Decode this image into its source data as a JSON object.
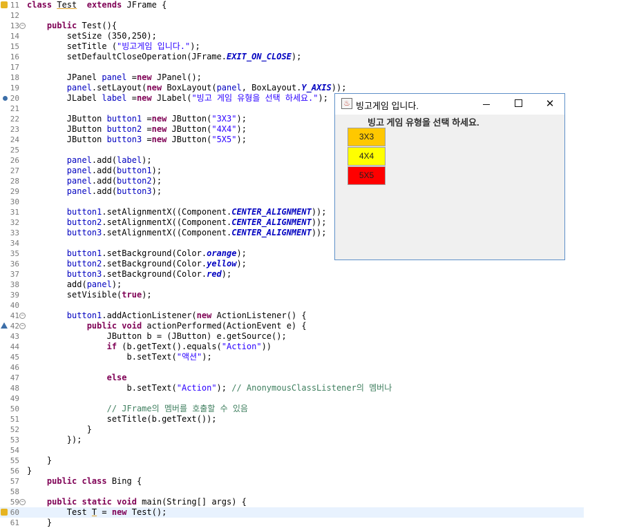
{
  "editor": {
    "lines": [
      {
        "num": "11",
        "segments": [
          [
            "kw",
            "class "
          ],
          [
            "ul",
            "Test"
          ],
          [
            "",
            "  "
          ],
          [
            "kw",
            "extends"
          ],
          [
            "",
            " JFrame {"
          ]
        ]
      },
      {
        "num": "12",
        "segments": []
      },
      {
        "num": "13",
        "segments": [
          [
            "",
            "    "
          ],
          [
            "kw",
            "public"
          ],
          [
            "",
            " Test(){"
          ]
        ]
      },
      {
        "num": "14",
        "segments": [
          [
            "",
            "        setSize (350,250);"
          ]
        ]
      },
      {
        "num": "15",
        "segments": [
          [
            "",
            "        setTitle ("
          ],
          [
            "str",
            "\"빙고게임 입니다.\""
          ],
          [
            "",
            ");"
          ]
        ]
      },
      {
        "num": "16",
        "segments": [
          [
            "",
            "        setDefaultCloseOperation(JFrame."
          ],
          [
            "sfld",
            "EXIT_ON_CLOSE"
          ],
          [
            "",
            ");"
          ]
        ]
      },
      {
        "num": "17",
        "segments": []
      },
      {
        "num": "18",
        "segments": [
          [
            "",
            "        JPanel "
          ],
          [
            "fld",
            "panel"
          ],
          [
            "",
            " ="
          ],
          [
            "kw",
            "new"
          ],
          [
            "",
            " JPanel();"
          ]
        ]
      },
      {
        "num": "19",
        "segments": [
          [
            "",
            "        "
          ],
          [
            "fld",
            "panel"
          ],
          [
            "",
            ".setLayout("
          ],
          [
            "kw",
            "new"
          ],
          [
            "",
            " BoxLayout("
          ],
          [
            "fld",
            "panel"
          ],
          [
            "",
            ", BoxLayout."
          ],
          [
            "sfld",
            "Y_AXIS"
          ],
          [
            "",
            "));"
          ]
        ]
      },
      {
        "num": "20",
        "segments": [
          [
            "",
            "        JLabel "
          ],
          [
            "fld",
            "label"
          ],
          [
            "",
            " ="
          ],
          [
            "kw",
            "new"
          ],
          [
            "",
            " JLabel("
          ],
          [
            "str",
            "\"빙고 게임 유형을 선택 하세요.\""
          ],
          [
            "",
            ");"
          ]
        ]
      },
      {
        "num": "21",
        "segments": []
      },
      {
        "num": "22",
        "segments": [
          [
            "",
            "        JButton "
          ],
          [
            "fld",
            "button1"
          ],
          [
            "",
            " ="
          ],
          [
            "kw",
            "new"
          ],
          [
            "",
            " JButton("
          ],
          [
            "str",
            "\"3X3\""
          ],
          [
            "",
            ");"
          ]
        ]
      },
      {
        "num": "23",
        "segments": [
          [
            "",
            "        JButton "
          ],
          [
            "fld",
            "button2"
          ],
          [
            "",
            " ="
          ],
          [
            "kw",
            "new"
          ],
          [
            "",
            " JButton("
          ],
          [
            "str",
            "\"4X4\""
          ],
          [
            "",
            ");"
          ]
        ]
      },
      {
        "num": "24",
        "segments": [
          [
            "",
            "        JButton "
          ],
          [
            "fld",
            "button3"
          ],
          [
            "",
            " ="
          ],
          [
            "kw",
            "new"
          ],
          [
            "",
            " JButton("
          ],
          [
            "str",
            "\"5X5\""
          ],
          [
            "",
            ");"
          ]
        ]
      },
      {
        "num": "25",
        "segments": []
      },
      {
        "num": "26",
        "segments": [
          [
            "",
            "        "
          ],
          [
            "fld",
            "panel"
          ],
          [
            "",
            ".add("
          ],
          [
            "fld",
            "label"
          ],
          [
            "",
            ");"
          ]
        ]
      },
      {
        "num": "27",
        "segments": [
          [
            "",
            "        "
          ],
          [
            "fld",
            "panel"
          ],
          [
            "",
            ".add("
          ],
          [
            "fld",
            "button1"
          ],
          [
            "",
            ");"
          ]
        ]
      },
      {
        "num": "28",
        "segments": [
          [
            "",
            "        "
          ],
          [
            "fld",
            "panel"
          ],
          [
            "",
            ".add("
          ],
          [
            "fld",
            "button2"
          ],
          [
            "",
            ");"
          ]
        ]
      },
      {
        "num": "29",
        "segments": [
          [
            "",
            "        "
          ],
          [
            "fld",
            "panel"
          ],
          [
            "",
            ".add("
          ],
          [
            "fld",
            "button3"
          ],
          [
            "",
            ");"
          ]
        ]
      },
      {
        "num": "30",
        "segments": []
      },
      {
        "num": "31",
        "segments": [
          [
            "",
            "        "
          ],
          [
            "fld",
            "button1"
          ],
          [
            "",
            ".setAlignmentX((Component."
          ],
          [
            "sfld",
            "CENTER_ALIGNMENT"
          ],
          [
            "",
            "));"
          ]
        ]
      },
      {
        "num": "32",
        "segments": [
          [
            "",
            "        "
          ],
          [
            "fld",
            "button2"
          ],
          [
            "",
            ".setAlignmentX((Component."
          ],
          [
            "sfld",
            "CENTER_ALIGNMENT"
          ],
          [
            "",
            "));"
          ]
        ]
      },
      {
        "num": "33",
        "segments": [
          [
            "",
            "        "
          ],
          [
            "fld",
            "button3"
          ],
          [
            "",
            ".setAlignmentX((Component."
          ],
          [
            "sfld",
            "CENTER_ALIGNMENT"
          ],
          [
            "",
            "));"
          ]
        ]
      },
      {
        "num": "34",
        "segments": []
      },
      {
        "num": "35",
        "segments": [
          [
            "",
            "        "
          ],
          [
            "fld",
            "button1"
          ],
          [
            "",
            ".setBackground(Color."
          ],
          [
            "sfld",
            "orange"
          ],
          [
            "",
            ");"
          ]
        ]
      },
      {
        "num": "36",
        "segments": [
          [
            "",
            "        "
          ],
          [
            "fld",
            "button2"
          ],
          [
            "",
            ".setBackground(Color."
          ],
          [
            "sfld",
            "yellow"
          ],
          [
            "",
            ");"
          ]
        ]
      },
      {
        "num": "37",
        "segments": [
          [
            "",
            "        "
          ],
          [
            "fld",
            "button3"
          ],
          [
            "",
            ".setBackground(Color."
          ],
          [
            "sfld",
            "red"
          ],
          [
            "",
            ");"
          ]
        ]
      },
      {
        "num": "38",
        "segments": [
          [
            "",
            "        add("
          ],
          [
            "fld",
            "panel"
          ],
          [
            "",
            ");"
          ]
        ]
      },
      {
        "num": "39",
        "segments": [
          [
            "",
            "        setVisible("
          ],
          [
            "kw",
            "true"
          ],
          [
            "",
            ");"
          ]
        ]
      },
      {
        "num": "40",
        "segments": []
      },
      {
        "num": "41",
        "segments": [
          [
            "",
            "        "
          ],
          [
            "fld",
            "button1"
          ],
          [
            "",
            ".addActionListener("
          ],
          [
            "kw",
            "new"
          ],
          [
            "",
            " ActionListener() {"
          ]
        ]
      },
      {
        "num": "42",
        "segments": [
          [
            "",
            "            "
          ],
          [
            "kw",
            "public"
          ],
          [
            "kw",
            " void"
          ],
          [
            "",
            " actionPerformed(ActionEvent e) {"
          ]
        ]
      },
      {
        "num": "43",
        "segments": [
          [
            "",
            "                JButton b = (JButton) e.getSource();"
          ]
        ]
      },
      {
        "num": "44",
        "segments": [
          [
            "",
            "                "
          ],
          [
            "kw",
            "if"
          ],
          [
            "",
            " (b.getText().equals("
          ],
          [
            "str",
            "\"Action\""
          ],
          [
            "",
            "))"
          ]
        ]
      },
      {
        "num": "45",
        "segments": [
          [
            "",
            "                    b.setText("
          ],
          [
            "str",
            "\"액션\""
          ],
          [
            "",
            ");"
          ]
        ]
      },
      {
        "num": "46",
        "segments": []
      },
      {
        "num": "47",
        "segments": [
          [
            "",
            "                "
          ],
          [
            "kw",
            "else"
          ]
        ]
      },
      {
        "num": "48",
        "segments": [
          [
            "",
            "                    b.setText("
          ],
          [
            "str",
            "\"Action\""
          ],
          [
            "",
            "); "
          ],
          [
            "cmt",
            "// AnonymousClassListener의 멤버나"
          ]
        ]
      },
      {
        "num": "49",
        "segments": []
      },
      {
        "num": "50",
        "segments": [
          [
            "",
            "                "
          ],
          [
            "cmt",
            "// JFrame의 멤버를 호출할 수 있음"
          ]
        ]
      },
      {
        "num": "51",
        "segments": [
          [
            "",
            "                setTitle(b.getText());"
          ]
        ]
      },
      {
        "num": "52",
        "segments": [
          [
            "",
            "            }"
          ]
        ]
      },
      {
        "num": "53",
        "segments": [
          [
            "",
            "        });"
          ]
        ]
      },
      {
        "num": "54",
        "segments": []
      },
      {
        "num": "55",
        "segments": [
          [
            "",
            "    }"
          ]
        ]
      },
      {
        "num": "56",
        "segments": [
          [
            "",
            "}"
          ]
        ]
      },
      {
        "num": "57",
        "segments": [
          [
            "",
            "    "
          ],
          [
            "kw",
            "public class"
          ],
          [
            "",
            " Bing {"
          ]
        ]
      },
      {
        "num": "58",
        "segments": []
      },
      {
        "num": "59",
        "segments": [
          [
            "",
            "    "
          ],
          [
            "kw",
            "public static void"
          ],
          [
            "",
            " main(String[] args) {"
          ]
        ]
      },
      {
        "num": "60",
        "segments": [
          [
            "",
            "        Test "
          ],
          [
            "ul",
            "T"
          ],
          [
            "",
            " = "
          ],
          [
            "kw",
            "new"
          ],
          [
            "",
            " Test();"
          ]
        ]
      },
      {
        "num": "61",
        "segments": [
          [
            "",
            "    }"
          ]
        ]
      }
    ],
    "fold_lines": [
      "13",
      "41",
      "42",
      "59"
    ],
    "warn_lines": [
      "11",
      "60"
    ],
    "breakpoint_lines": [
      "20"
    ],
    "override_lines": [
      "42"
    ],
    "current_line": "60"
  },
  "window": {
    "title": "빙고게임 입니다.",
    "icon": "java-cup-icon",
    "close_glyph": "✕",
    "label": "빙고 게임 유형을 선택 하세요.",
    "buttons": [
      {
        "text": "3X3",
        "color": "#ffc800"
      },
      {
        "text": "4X4",
        "color": "#ffff00"
      },
      {
        "text": "5X5",
        "color": "#ff0000"
      }
    ]
  }
}
